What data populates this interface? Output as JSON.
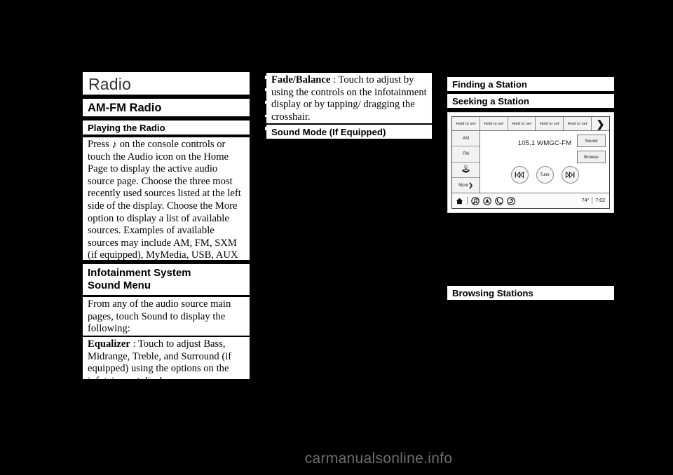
{
  "page": {
    "background_color": "#000000",
    "text_block_color": "#ffffff",
    "watermark": "carmanualsonline.info"
  },
  "column1": {
    "chapter_title": "Radio",
    "section_title": "AM-FM Radio",
    "subsection_title": "Playing the Radio",
    "playing_para_before_icon": "Press",
    "playing_icon": "music-note-icon",
    "playing_para_after_icon": "on the console controls or touch the Audio icon on the Home Page to display the active audio source page. Choose the three most recently used sources listed at the left side of the display. Choose the More option to display a list of available sources. Examples of available sources may include AM, FM, SXM (if equipped), MyMedia, USB, AUX (if equipped), and Bluetooth.",
    "sound_menu_heading_line1": "Infotainment System",
    "sound_menu_heading_line2": "Sound Menu",
    "sound_menu_intro": "From any of the audio source main pages, touch Sound to display the following:",
    "equalizer_term": "Equalizer",
    "equalizer_sep": " : ",
    "equalizer_def": "Touch to adjust Bass, Midrange, Treble, and Surround (if equipped) using the options on the infotainment display."
  },
  "column2": {
    "fade_balance_term": "Fade/Balance",
    "fade_balance_sep": " : ",
    "fade_balance_def": "Touch to adjust by using the controls on the infotainment display or by tapping/ dragging the crosshair.",
    "sound_mode_heading": "Sound Mode (If Equipped)"
  },
  "column3": {
    "finding_heading": "Finding a Station",
    "seeking_heading": "Seeking a Station",
    "browsing_heading": "Browsing Stations"
  },
  "infotainment": {
    "presets": [
      {
        "label": "Hold to set"
      },
      {
        "label": "Hold to set"
      },
      {
        "label": "Hold to set"
      },
      {
        "label": "Hold to set"
      },
      {
        "label": "Hold to set"
      }
    ],
    "preset_next_icon": "chevron-right-icon",
    "sources": [
      {
        "label": "AM",
        "icon": ""
      },
      {
        "label": "FM",
        "icon": ""
      },
      {
        "label": "",
        "icon": "bluetooth-icon"
      },
      {
        "label": "More",
        "icon": "chevron-right-icon"
      }
    ],
    "station_label": "105.1 WMGC-FM",
    "transport": [
      {
        "name": "seek-previous-button",
        "label": "",
        "icon": "skip-previous-icon"
      },
      {
        "name": "tune-button",
        "label": "Tune",
        "icon": ""
      },
      {
        "name": "seek-next-button",
        "label": "",
        "icon": "skip-next-icon"
      }
    ],
    "right_buttons": [
      {
        "label": "Sound"
      },
      {
        "label": "Browse"
      }
    ],
    "status_icons": [
      "home-icon",
      "audio-note-icon",
      "navigation-arrow-icon",
      "phone-icon",
      "settings-icon"
    ],
    "temperature": "74°",
    "time": "7:02"
  }
}
